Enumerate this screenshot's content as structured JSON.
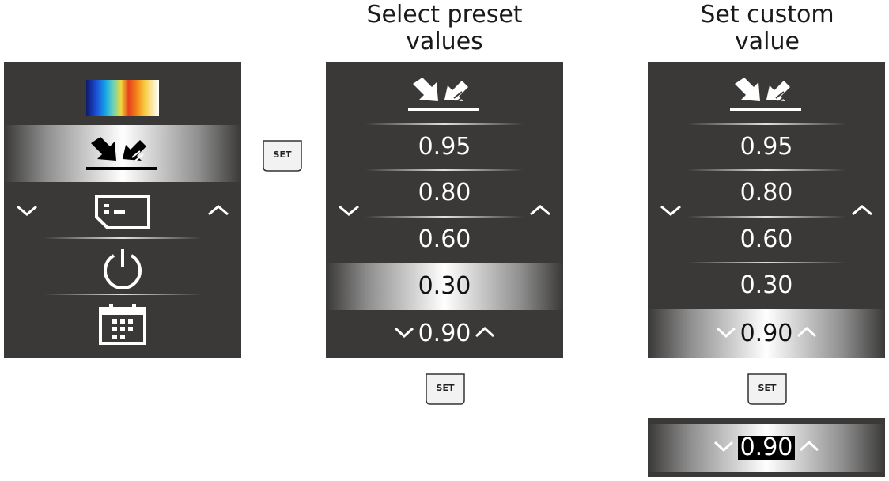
{
  "headings": {
    "preset": "Select preset\nvalues",
    "custom": "Set custom\nvalue"
  },
  "set_button_label": "SET",
  "menu": {
    "items": [
      "palette-icon",
      "emissivity-icon",
      "sd-card-icon",
      "power-icon",
      "calendar-icon"
    ],
    "selected": "emissivity-icon"
  },
  "preset_screen": {
    "header_icon": "emissivity-icon",
    "values": [
      "0.95",
      "0.80",
      "0.60",
      "0.30"
    ],
    "custom_value": "0.90",
    "selected_value": "0.30"
  },
  "custom_screen": {
    "header_icon": "emissivity-icon",
    "values": [
      "0.95",
      "0.80",
      "0.60",
      "0.30"
    ],
    "custom_value": "0.90",
    "selected_value": "0.90"
  },
  "edit_strip": {
    "value": "0.90"
  }
}
